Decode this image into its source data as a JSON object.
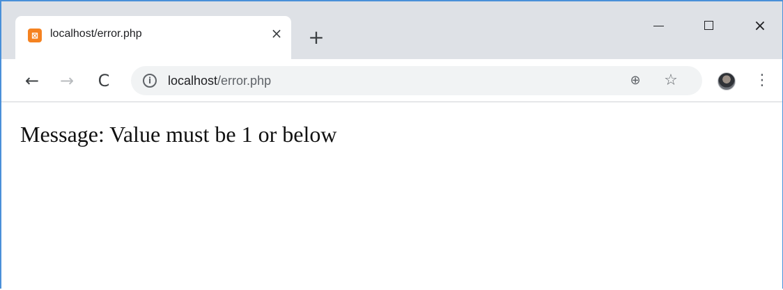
{
  "browser": {
    "tab": {
      "favicon_glyph": "⊠",
      "title": "localhost/error.php",
      "close_glyph": "×"
    },
    "new_tab_glyph": "+",
    "window_controls": {
      "close_glyph": "×"
    },
    "toolbar": {
      "back_glyph": "←",
      "forward_glyph": "→",
      "reload_glyph": "C",
      "info_glyph": "i",
      "url_host": "localhost",
      "url_path": "/error.php",
      "zoom_glyph": "⊕",
      "star_glyph": "☆",
      "menu_glyph": "⋮"
    }
  },
  "page": {
    "message": "Message: Value must be 1 or below"
  },
  "icons": {
    "favicon": "xampp-icon",
    "zoom": "zoom-icon",
    "bookmark": "star-icon",
    "profile": "avatar"
  },
  "colors": {
    "titlebar": "#dee1e6",
    "tab": "#ffffff",
    "omnibox": "#f1f3f4",
    "favicon": "#f58220"
  }
}
